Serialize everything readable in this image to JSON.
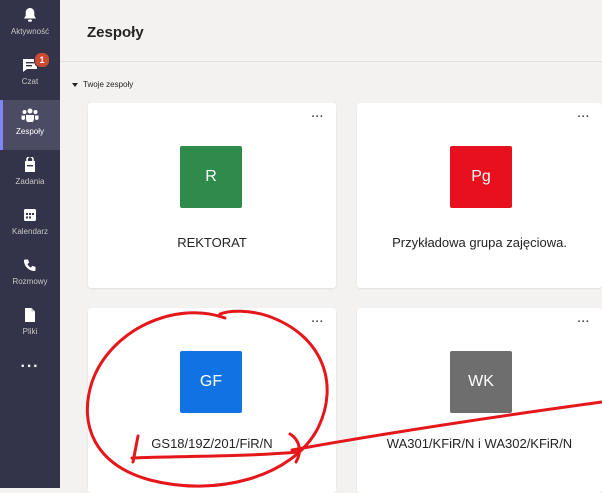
{
  "rail": {
    "items": [
      {
        "label": "Aktywność",
        "icon": "bell-icon"
      },
      {
        "label": "Czat",
        "icon": "chat-icon",
        "badge": "1"
      },
      {
        "label": "Zespoły",
        "icon": "teams-icon",
        "active": true
      },
      {
        "label": "Zadania",
        "icon": "assignments-icon"
      },
      {
        "label": "Kalendarz",
        "icon": "calendar-icon"
      },
      {
        "label": "Rozmowy",
        "icon": "phone-icon"
      },
      {
        "label": "Pliki",
        "icon": "file-icon"
      }
    ],
    "more_label": "···"
  },
  "header": {
    "title": "Zespoły"
  },
  "section": {
    "label": "Twoje zespoły"
  },
  "teams": [
    {
      "initials": "R",
      "name": "REKTORAT",
      "color": "#2e8b4b"
    },
    {
      "initials": "Pg",
      "name": "Przykładowa grupa zajęciowa.",
      "color": "#e8101e"
    },
    {
      "initials": "GF",
      "name": "GS18/19Z/201/FiR/N",
      "color": "#1172e3"
    },
    {
      "initials": "WK",
      "name": "WA301/KFiR/N i WA302/KFiR/N",
      "color": "#6e6e6e"
    }
  ],
  "card_menu_label": "···"
}
